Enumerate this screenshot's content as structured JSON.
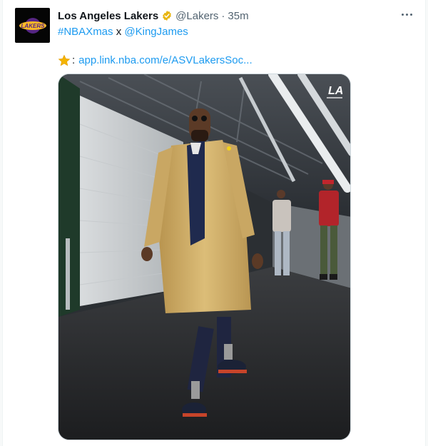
{
  "tweet": {
    "author_name": "Los Angeles Lakers",
    "handle": "@Lakers",
    "separator": "·",
    "time": "35m",
    "hashtag": "#NBAXmas",
    "connector": "x",
    "mention": "@KingJames",
    "link_prefix": ":",
    "link": "app.link.nba.com/e/ASVLakersSoc...",
    "avatar_logo_text": "LAKERS",
    "photo_logo_text": "LA"
  },
  "icons": {
    "verified": "verified-badge-icon",
    "star": "star-emoji",
    "more": "more-options-icon"
  },
  "colors": {
    "link": "#1d9bf0",
    "verified": "#e8b510",
    "lakers_gold": "#fdb927",
    "lakers_purple": "#552583"
  }
}
